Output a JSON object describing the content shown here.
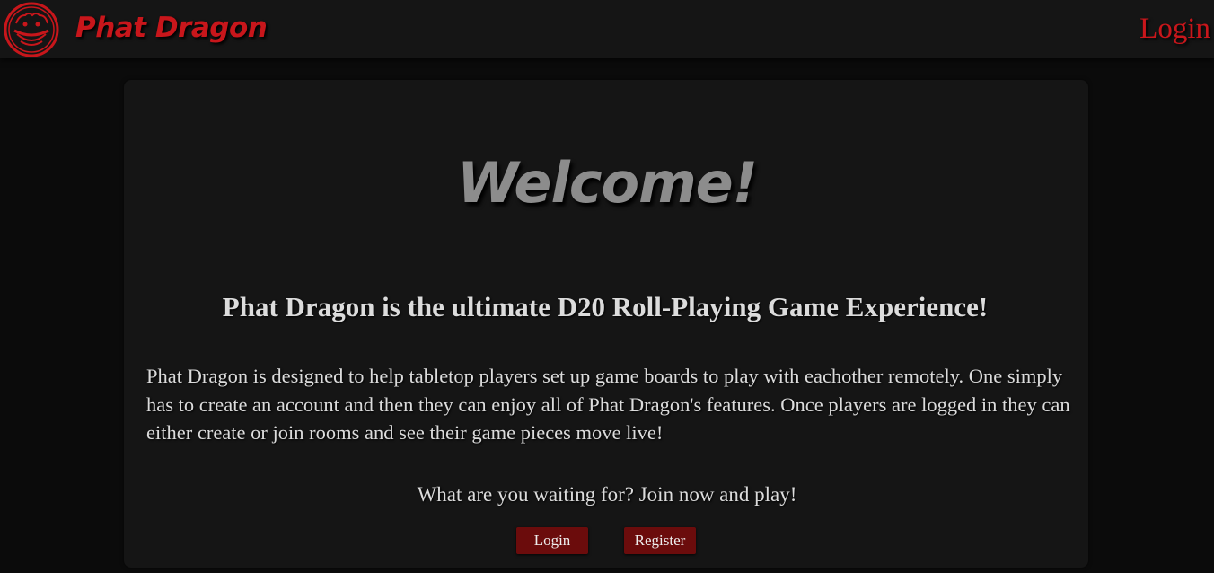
{
  "colors": {
    "accent_red": "#c8161b",
    "text_light": "#dcdcdc",
    "welcome_gray": "#8c8c8c",
    "button_bg": "#6b0c0c",
    "button_text": "#eeeeee",
    "navbar_bg": "#151515",
    "page_bg": "#0b0b0b",
    "card_bg": "#151515"
  },
  "navbar": {
    "logo_icon": "dragon-logo-icon",
    "brand": "Phat Dragon",
    "login_link": "Login"
  },
  "main": {
    "welcome": "Welcome!",
    "subtitle": "Phat Dragon is the ultimate D20 Roll-Playing Game Experience!",
    "description": "Phat Dragon is designed to help tabletop players set up game boards to play with eachother remotely. One simply has to create an account and then they can enjoy all of Phat Dragon's features. Once players are logged in they can either create or join rooms and see their game pieces move live!",
    "cta": "What are you waiting for? Join now and play!",
    "login_button": "Login",
    "register_button": "Register"
  }
}
